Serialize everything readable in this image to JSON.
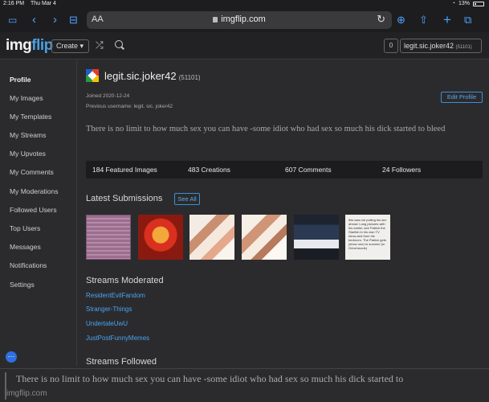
{
  "status": {
    "time": "2:16 PM",
    "date": "Thu Mar 4",
    "battery": "13%"
  },
  "browser": {
    "aa": "AA",
    "url": "imgflip.com"
  },
  "site": {
    "logo_a": "img",
    "logo_b": "flip",
    "create_label": "Create ▾",
    "points_box": "0",
    "user_label": "legit.sic.joker42",
    "user_points": "(51101)"
  },
  "sidebar": {
    "items": [
      {
        "label": "Profile"
      },
      {
        "label": "My Images"
      },
      {
        "label": "My Templates"
      },
      {
        "label": "My Streams"
      },
      {
        "label": "My Upvotes"
      },
      {
        "label": "My Comments"
      },
      {
        "label": "My Moderations"
      },
      {
        "label": "Followed Users"
      },
      {
        "label": "Top Users"
      },
      {
        "label": "Messages"
      },
      {
        "label": "Notifications"
      },
      {
        "label": "Settings"
      }
    ]
  },
  "profile": {
    "username": "legit.sic.joker42",
    "points": "(51101)",
    "joined": "Joined 2020-12-24",
    "previous": "Previous username: legit. sic. joker42",
    "edit_label": "Edit Profile",
    "bio": "There is no limit to how much sex you can have -some idiot who had sex so much his dick started to bleed",
    "stats": [
      "184 Featured Images",
      "483 Creations",
      "607 Comments",
      "24 Followers"
    ]
  },
  "latest": {
    "title": "Latest Submissions",
    "see_all": "See All",
    "thumb6_text": "this was me pulling his sex ahead: Long pictures with his earlier, see Patrick the Starfish in his own TV show-and from his bedroom. The Patrick gets (show one) to summer (in Grinchmode)"
  },
  "streams_moderated": {
    "title": "Streams Moderated",
    "items": [
      "ResidentEvilFandom",
      "Stranger-Things",
      "UndertaleUwU",
      "JustPostFunnyMemes"
    ]
  },
  "streams_followed": {
    "title": "Streams Followed"
  },
  "caption": {
    "text": "There is no limit to how much sex you can have -some idiot who had sex so much his dick started to",
    "watermark": "imgflip.com"
  }
}
